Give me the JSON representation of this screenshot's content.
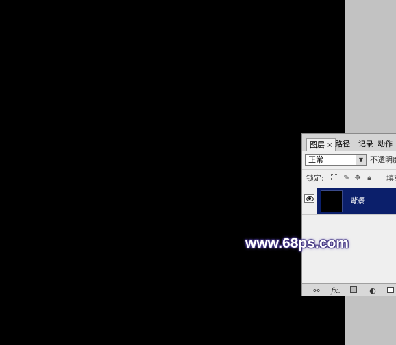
{
  "panel": {
    "tabs": [
      {
        "label": "图层",
        "close": "×"
      },
      {
        "label": "路径"
      },
      {
        "label": "记录"
      },
      {
        "label": "动作"
      }
    ],
    "blend_mode": "正常",
    "opacity_label": "不透明度:",
    "lock_label": "锁定:",
    "fill_label": "填充:",
    "layers": [
      {
        "name": "背景",
        "visible": true,
        "selected": true
      }
    ],
    "bottom_icons": [
      "link-icon",
      "fx-icon",
      "mask-icon",
      "adjustment-icon",
      "new-layer-icon"
    ],
    "fx_label": "fx."
  },
  "colors": {
    "canvas": "#000000",
    "workspace": "#c2c2c2",
    "selection": "#0b1f6b",
    "panel_bg": "#efefef"
  },
  "watermark": "www.68ps.com"
}
